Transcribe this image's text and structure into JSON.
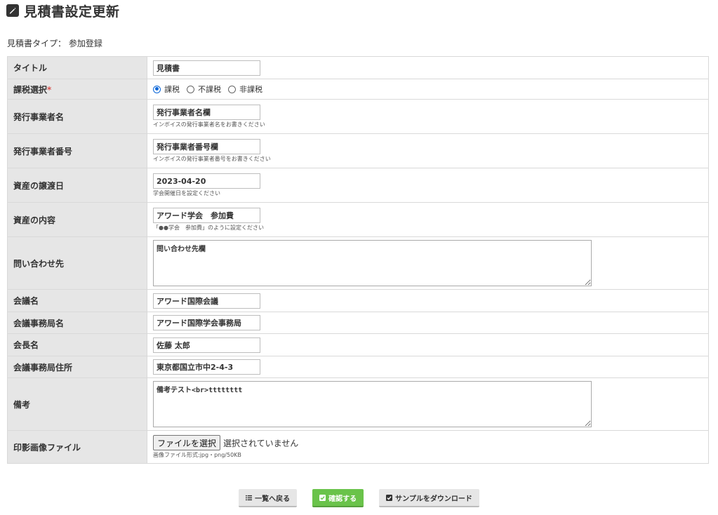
{
  "page": {
    "title": "見積書設定更新",
    "type_label": "見積書タイプ：",
    "type_value": "参加登録"
  },
  "form": {
    "title": {
      "label": "タイトル",
      "value": "見積書"
    },
    "tax": {
      "label": "課税選択",
      "required_mark": "*",
      "options": [
        "課税",
        "不課税",
        "非課税"
      ],
      "selected": "課税"
    },
    "issuer_name": {
      "label": "発行事業者名",
      "value": "発行事業者名欄",
      "hint": "インボイスの発行事業者名をお書きください"
    },
    "issuer_number": {
      "label": "発行事業者番号",
      "value": "発行事業者番号欄",
      "hint": "インボイスの発行事業者番号をお書きください"
    },
    "transfer_date": {
      "label": "資産の譲渡日",
      "value": "2023-04-20",
      "hint": "学会開催日を設定ください"
    },
    "asset_content": {
      "label": "資産の内容",
      "value": "アワード学会　参加費",
      "hint": "「●●学会　参加費」のように設定ください"
    },
    "contact": {
      "label": "問い合わせ先",
      "value": "問い合わせ先欄"
    },
    "conference_name": {
      "label": "会議名",
      "value": "アワード国際会議"
    },
    "secretariat_name": {
      "label": "会議事務局名",
      "value": "アワード国際学会事務局"
    },
    "president_name": {
      "label": "会長名",
      "value": "佐藤 太郎"
    },
    "secretariat_address": {
      "label": "会議事務局住所",
      "value": "東京都国立市中2-4-3"
    },
    "remarks": {
      "label": "備考",
      "value": "備考テスト<br>tttttttt"
    },
    "seal_image": {
      "label": "印影画像ファイル",
      "button": "ファイルを選択",
      "status": "選択されていません",
      "hint": "画像ファイル形式:jpg・png/50KB"
    }
  },
  "actions": {
    "back": "一覧へ戻る",
    "confirm": "確認する",
    "download_sample": "サンプルをダウンロード"
  },
  "colors": {
    "label_bg": "#e6e6e6",
    "confirm_green": "#6ac34a",
    "radio_blue": "#0a66d8",
    "required_red": "#d9534f"
  },
  "icons": {
    "title": "edit-icon",
    "back": "list-icon",
    "confirm": "check-square-icon",
    "download": "check-square-icon"
  }
}
